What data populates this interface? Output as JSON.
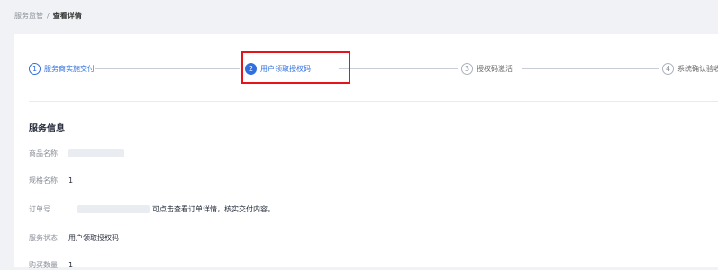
{
  "breadcrumb": {
    "parent": "服务监管",
    "separator": "/",
    "current": "查看详情"
  },
  "steps": [
    {
      "num": "1",
      "label": "服务商实施交付",
      "state": "done"
    },
    {
      "num": "2",
      "label": "用户领取授权码",
      "state": "active"
    },
    {
      "num": "3",
      "label": "授权码激活",
      "state": "pending"
    },
    {
      "num": "4",
      "label": "系统确认验收",
      "state": "pending"
    }
  ],
  "service_info": {
    "title": "服务信息",
    "product_name_label": "商品名称",
    "spec_name_label": "规格名称",
    "spec_name_value": "1",
    "order_no_label": "订单号",
    "order_hint": "可点击查看订单详情，核实交付内容。",
    "status_label": "服务状态",
    "status_value": "用户领取授权码",
    "quantity_label": "购买数量",
    "quantity_value": "1"
  },
  "colors": {
    "accent": "#2f6fde",
    "highlight": "#e5141a"
  }
}
